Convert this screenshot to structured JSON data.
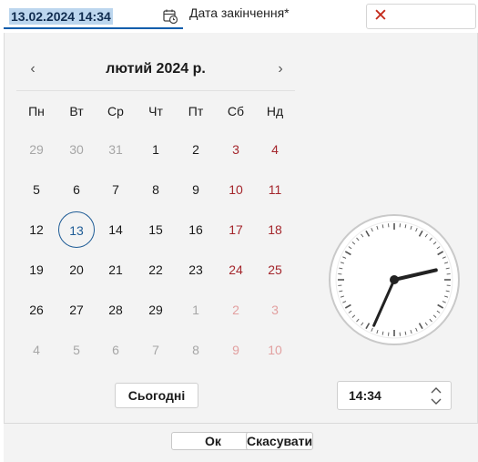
{
  "start_field": {
    "value": "13.02.2024 14:34",
    "icon": "calendar-clock-icon"
  },
  "end_field": {
    "label": "Дата закінчення*",
    "clear_icon": "close-icon",
    "clear_symbol": "✕"
  },
  "calendar": {
    "title": "лютий 2024 р.",
    "prev_symbol": "‹",
    "next_symbol": "›",
    "weekdays": [
      "Пн",
      "Вт",
      "Ср",
      "Чт",
      "Пт",
      "Сб",
      "Нд"
    ],
    "weeks": [
      [
        "29",
        "30",
        "31",
        "1",
        "2",
        "3",
        "4"
      ],
      [
        "5",
        "6",
        "7",
        "8",
        "9",
        "10",
        "11"
      ],
      [
        "12",
        "13",
        "14",
        "15",
        "16",
        "17",
        "18"
      ],
      [
        "19",
        "20",
        "21",
        "22",
        "23",
        "24",
        "25"
      ],
      [
        "26",
        "27",
        "28",
        "29",
        "1",
        "2",
        "3"
      ],
      [
        "4",
        "5",
        "6",
        "7",
        "8",
        "9",
        "10"
      ]
    ],
    "selected_day": "13",
    "today_button": "Сьогодні"
  },
  "clock": {
    "hour": 14,
    "minute": 34
  },
  "time_field": {
    "value": "14:34"
  },
  "footer": {
    "ok_label": "Ок",
    "cancel_label": "Скасувати"
  },
  "colors": {
    "accent": "#0f5eac",
    "selection": "#bcd6ee",
    "weekend": "#a4262c",
    "today_ring": "#1f5c96",
    "clear": "#c42b1c"
  }
}
